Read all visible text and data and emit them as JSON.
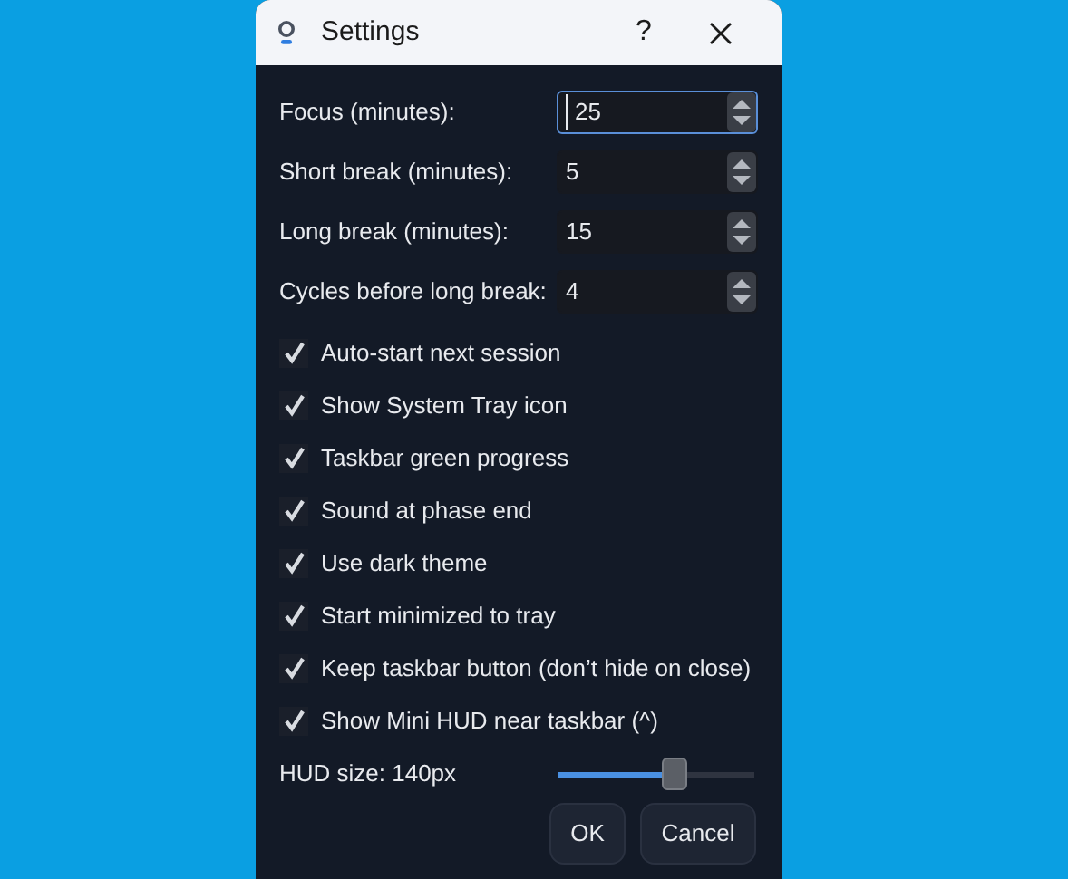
{
  "window": {
    "title": "Settings",
    "help": "?"
  },
  "spinboxes": [
    {
      "label": "Focus (minutes):",
      "value": "25",
      "focused": true
    },
    {
      "label": "Short break (minutes):",
      "value": "5",
      "focused": false
    },
    {
      "label": "Long break (minutes):",
      "value": "15",
      "focused": false
    },
    {
      "label": "Cycles before long break:",
      "value": "4",
      "focused": false
    }
  ],
  "checkboxes": [
    {
      "label": "Auto-start next session",
      "checked": true
    },
    {
      "label": "Show System Tray icon",
      "checked": true
    },
    {
      "label": "Taskbar green progress",
      "checked": true
    },
    {
      "label": "Sound at phase end",
      "checked": true
    },
    {
      "label": "Use dark theme",
      "checked": true
    },
    {
      "label": "Start minimized to tray",
      "checked": true
    },
    {
      "label": "Keep taskbar button (don’t hide on close)",
      "checked": true
    },
    {
      "label": "Show Mini HUD near taskbar (^)",
      "checked": true
    }
  ],
  "hud_size": {
    "label": "HUD size: 140px",
    "level": 0.59
  },
  "buttons": [
    "OK",
    "Cancel"
  ]
}
